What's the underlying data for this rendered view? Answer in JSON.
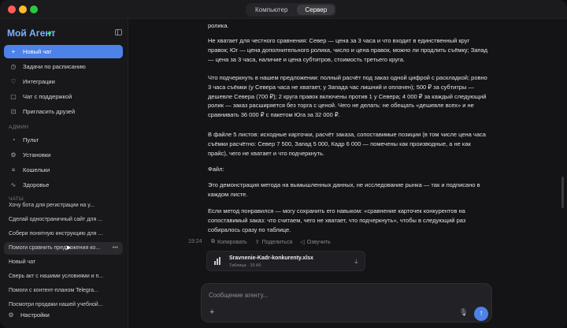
{
  "window": {
    "tabs": [
      {
        "label": "Компьютер",
        "active": false
      },
      {
        "label": "Сервер",
        "active": true
      }
    ]
  },
  "sidebar": {
    "brand": "Мой Агент",
    "collapse_icon": "sidebar-toggle-icon",
    "items": [
      {
        "label": "Новый чат",
        "icon": "plus-icon",
        "active": true
      },
      {
        "label": "Задачи по расписанию",
        "icon": "clock-icon"
      },
      {
        "label": "Интеграции",
        "icon": "plug-icon"
      },
      {
        "label": "Чат с поддержкой",
        "icon": "chat-icon"
      },
      {
        "label": "Пригласить друзей",
        "icon": "gift-icon"
      }
    ],
    "admin_label": "АДМИН",
    "admin_items": [
      {
        "label": "Пульт",
        "icon": "gauge-icon"
      },
      {
        "label": "Установки",
        "icon": "settings-icon"
      },
      {
        "label": "Кошельки",
        "icon": "wallet-icon"
      },
      {
        "label": "Здоровье",
        "icon": "health-icon"
      }
    ],
    "chats_label": "ЧАТЫ",
    "chats": [
      {
        "label": "Хочу бота для регистрации на у..."
      },
      {
        "label": "Сделай одностраничный сайт для ..."
      },
      {
        "label": "Собери понятную инструкцию для ..."
      },
      {
        "label": "Помоги сравнить предложения ко...",
        "active": true
      },
      {
        "label": "Новый чат"
      },
      {
        "label": "Сверь акт с нашими условиями и п..."
      },
      {
        "label": "Помоги с контент-планом Telegra..."
      },
      {
        "label": "Посмотри продажи нашей учебной..."
      }
    ],
    "settings_label": "Настройки",
    "active_chat_menu": "•••"
  },
  "message": {
    "paragraphs": [
      "ролика.",
      "Не хватает для честного сравнения: Север — цена за 3 часа и что входит в единственный круг правок; Юг — цена дополнительного ролика, число и цена правок, можно ли продлить съёмку; Запад — цена за 3 часа, наличие и цена субтитров, стоимость третьего круга.",
      "Что подчеркнуть в нашем предложении: полный расчёт под заказ одной цифрой с раскладкой; ровно 3 часа съёмки (у Севера часа не хватает, у Запада час лишний и оплачен); 500 ₽ за субтитры — дешевле Севера (700 ₽); 2 круга правок включены против 1 у Севера; 4 000 ₽ за каждый следующий ролик — заказ расширяется без торга с ценой. Чего не делать: не обещать «дешевле всех» и не сравнивать 36 000 ₽ с пакетом Юга за 32 000 ₽.",
      "В файле 5 листов: исходные карточки, расчёт заказа, сопоставимые позиции (в том числе цена часа съёмки расчётно: Север 7 500, Запад 5 000, Кадр 6 000 — помечены как производные, а не как прайс), чего не хватает и что подчеркнуть.",
      "Файл:",
      "Это демонстрация метода на вымышленных данных, не исследование рынка — так и подписано в каждом листе.",
      "Если метод понравился — могу сохранить его навыком: «сравнение карточек конкурентов на сопоставимый заказ: что считаем, чего не хватает, что подчеркнуть», чтобы в следующий раз собиралось сразу по таблице."
    ],
    "timestamp": "19:24",
    "actions": [
      {
        "label": "Копировать",
        "icon": "copy-icon"
      },
      {
        "label": "Поделиться",
        "icon": "share-icon"
      },
      {
        "label": "Озвучить",
        "icon": "speaker-icon"
      }
    ],
    "file": {
      "name": "Sravnenie-Kadr-konkurenty.xlsx",
      "meta": "Таблица · 15 Кб"
    }
  },
  "composer": {
    "placeholder": "Сообщение агенту...",
    "value": ""
  },
  "colors": {
    "accent": "#4d82e8",
    "brand": "#7eb2ff",
    "status_online": "#3ddc84"
  }
}
